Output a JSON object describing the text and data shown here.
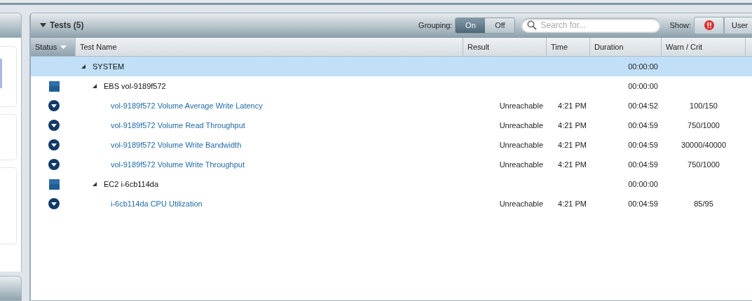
{
  "panel": {
    "title": "Tests (5)",
    "expanded": true
  },
  "grouping": {
    "label": "Grouping:",
    "options": [
      {
        "label": "On",
        "selected": true
      },
      {
        "label": "Off",
        "selected": false
      }
    ]
  },
  "search": {
    "placeholder": "Search for..."
  },
  "show": {
    "label": "Show:",
    "buttons": [
      {
        "kind": "alert"
      },
      {
        "kind": "text",
        "label": "User"
      }
    ]
  },
  "table": {
    "columns": [
      {
        "label": "Status",
        "sorted": true
      },
      {
        "label": "Test Name",
        "sorted": false
      },
      {
        "label": "Result",
        "sorted": false
      },
      {
        "label": "Time",
        "sorted": false
      },
      {
        "label": "Duration",
        "sorted": false
      },
      {
        "label": "Warn / Crit",
        "sorted": false
      }
    ],
    "rows": [
      {
        "name": "SYSTEM",
        "kind": "root",
        "selected": true,
        "expanded": true,
        "duration": "00:00:00",
        "children": [
          {
            "name": "EBS vol-9189f572",
            "kind": "group",
            "selected": false,
            "expanded": true,
            "duration": "00:00:00",
            "children": [
              {
                "name": "vol-9189f572 Volume Average Write Latency",
                "kind": "test",
                "selected": false,
                "result": "Unreachable",
                "time": "4:21 PM",
                "duration": "00:04:52",
                "warn_crit": "100/150"
              },
              {
                "name": "vol-9189f572 Volume Read Throughput",
                "kind": "test",
                "selected": false,
                "result": "Unreachable",
                "time": "4:21 PM",
                "duration": "00:04:59",
                "warn_crit": "750/1000"
              },
              {
                "name": "vol-9189f572 Volume Write Bandwidth",
                "kind": "test",
                "selected": false,
                "result": "Unreachable",
                "time": "4:21 PM",
                "duration": "00:04:59",
                "warn_crit": "30000/40000"
              },
              {
                "name": "vol-9189f572 Volume Write Throughput",
                "kind": "test",
                "selected": false,
                "result": "Unreachable",
                "time": "4:21 PM",
                "duration": "00:04:59",
                "warn_crit": "750/1000"
              }
            ]
          },
          {
            "name": "EC2 i-6cb114da",
            "kind": "group",
            "selected": false,
            "expanded": true,
            "duration": "00:00:00",
            "children": [
              {
                "name": "i-6cb114da CPU Utilization",
                "kind": "test",
                "selected": false,
                "result": "Unreachable",
                "time": "4:21 PM",
                "duration": "00:04:59",
                "warn_crit": "85/95"
              }
            ]
          }
        ]
      }
    ]
  }
}
